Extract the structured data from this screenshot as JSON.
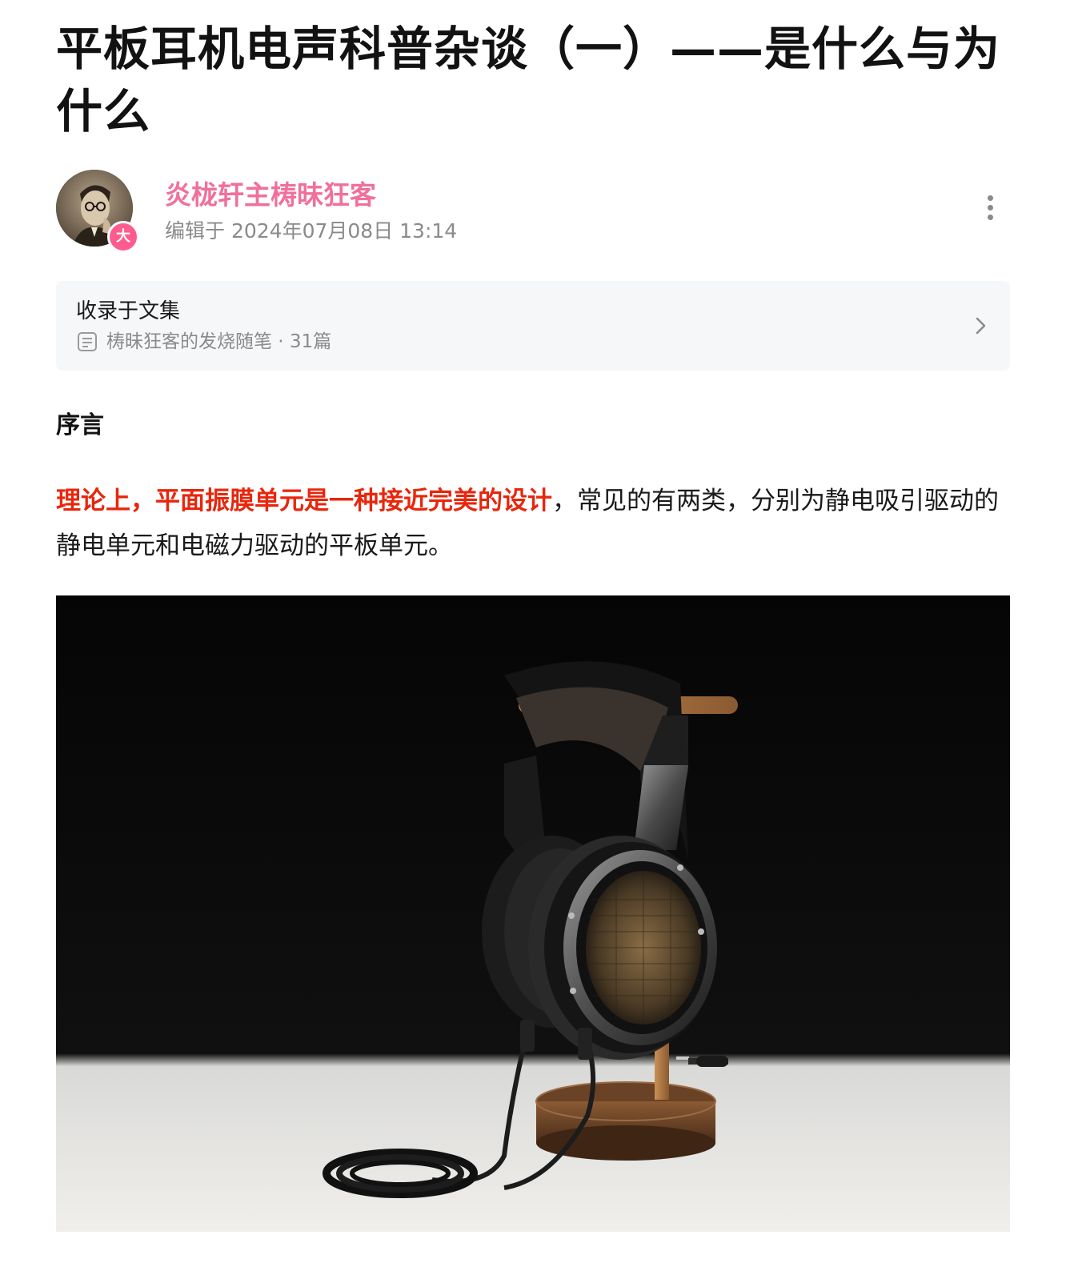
{
  "article": {
    "title": "平板耳机电声科普杂谈（一）——是什么与为什么"
  },
  "author": {
    "name": "炎栊轩主梼昧狂客",
    "badge": "大",
    "edit_time": "编辑于 2024年07月08日 13:14"
  },
  "collection": {
    "label": "收录于文集",
    "name_and_count": "梼昧狂客的发烧随笔 · 31篇"
  },
  "content": {
    "heading": "序言",
    "highlight": "理论上，平面振膜单元是一种接近完美的设计",
    "rest": "，常见的有两类，分别为静电吸引驱动的静电单元和电磁力驱动的平板单元。"
  },
  "colors": {
    "author_name": "#f0709b",
    "highlight": "#e8260c",
    "badge": "#ff5b8f",
    "card_bg": "#f6f7f9"
  }
}
